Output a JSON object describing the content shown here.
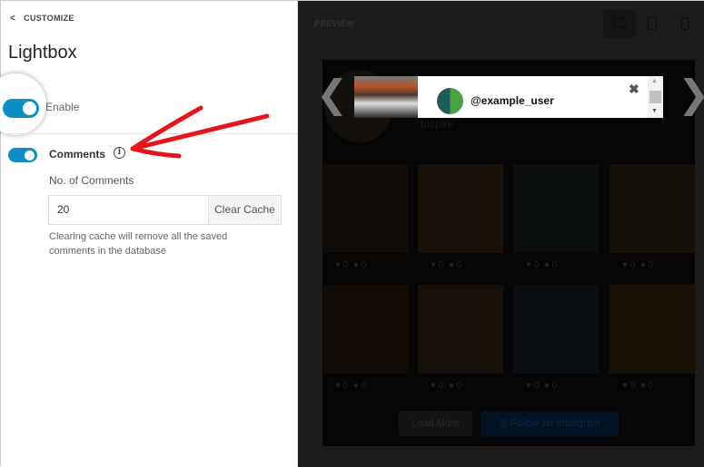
{
  "sidebar": {
    "back_label": "CUSTOMIZE",
    "title": "Lightbox",
    "enable_label": "Enable",
    "enable_on": true,
    "comments_label": "Comments",
    "comments_on": true,
    "no_comments_label": "No. of Comments",
    "no_comments_value": "20",
    "clear_cache_label": "Clear Cache",
    "help_text": "Clearing cache will remove all the saved comments in the database"
  },
  "preview": {
    "label": "PREVIEW",
    "devices": [
      "desktop-icon",
      "tablet-icon",
      "mobile-icon"
    ],
    "active_device": "desktop",
    "header_name": "Inspire",
    "posts": [
      {
        "likes": "0",
        "comments": "0"
      },
      {
        "likes": "0",
        "comments": "0"
      },
      {
        "likes": "0",
        "comments": "0"
      },
      {
        "likes": "0",
        "comments": "0"
      },
      {
        "likes": "0",
        "comments": "0"
      },
      {
        "likes": "0",
        "comments": "0"
      },
      {
        "likes": "0",
        "comments": "0"
      },
      {
        "likes": "0",
        "comments": "0"
      }
    ],
    "load_more": "Load More",
    "follow": "Follow on Instagram"
  },
  "lightbox": {
    "username": "@example_user",
    "close": "✖",
    "prev": "❮",
    "next": "❯"
  },
  "colors": {
    "accent": "#0d8fc6",
    "annotation": "#e8141b"
  }
}
